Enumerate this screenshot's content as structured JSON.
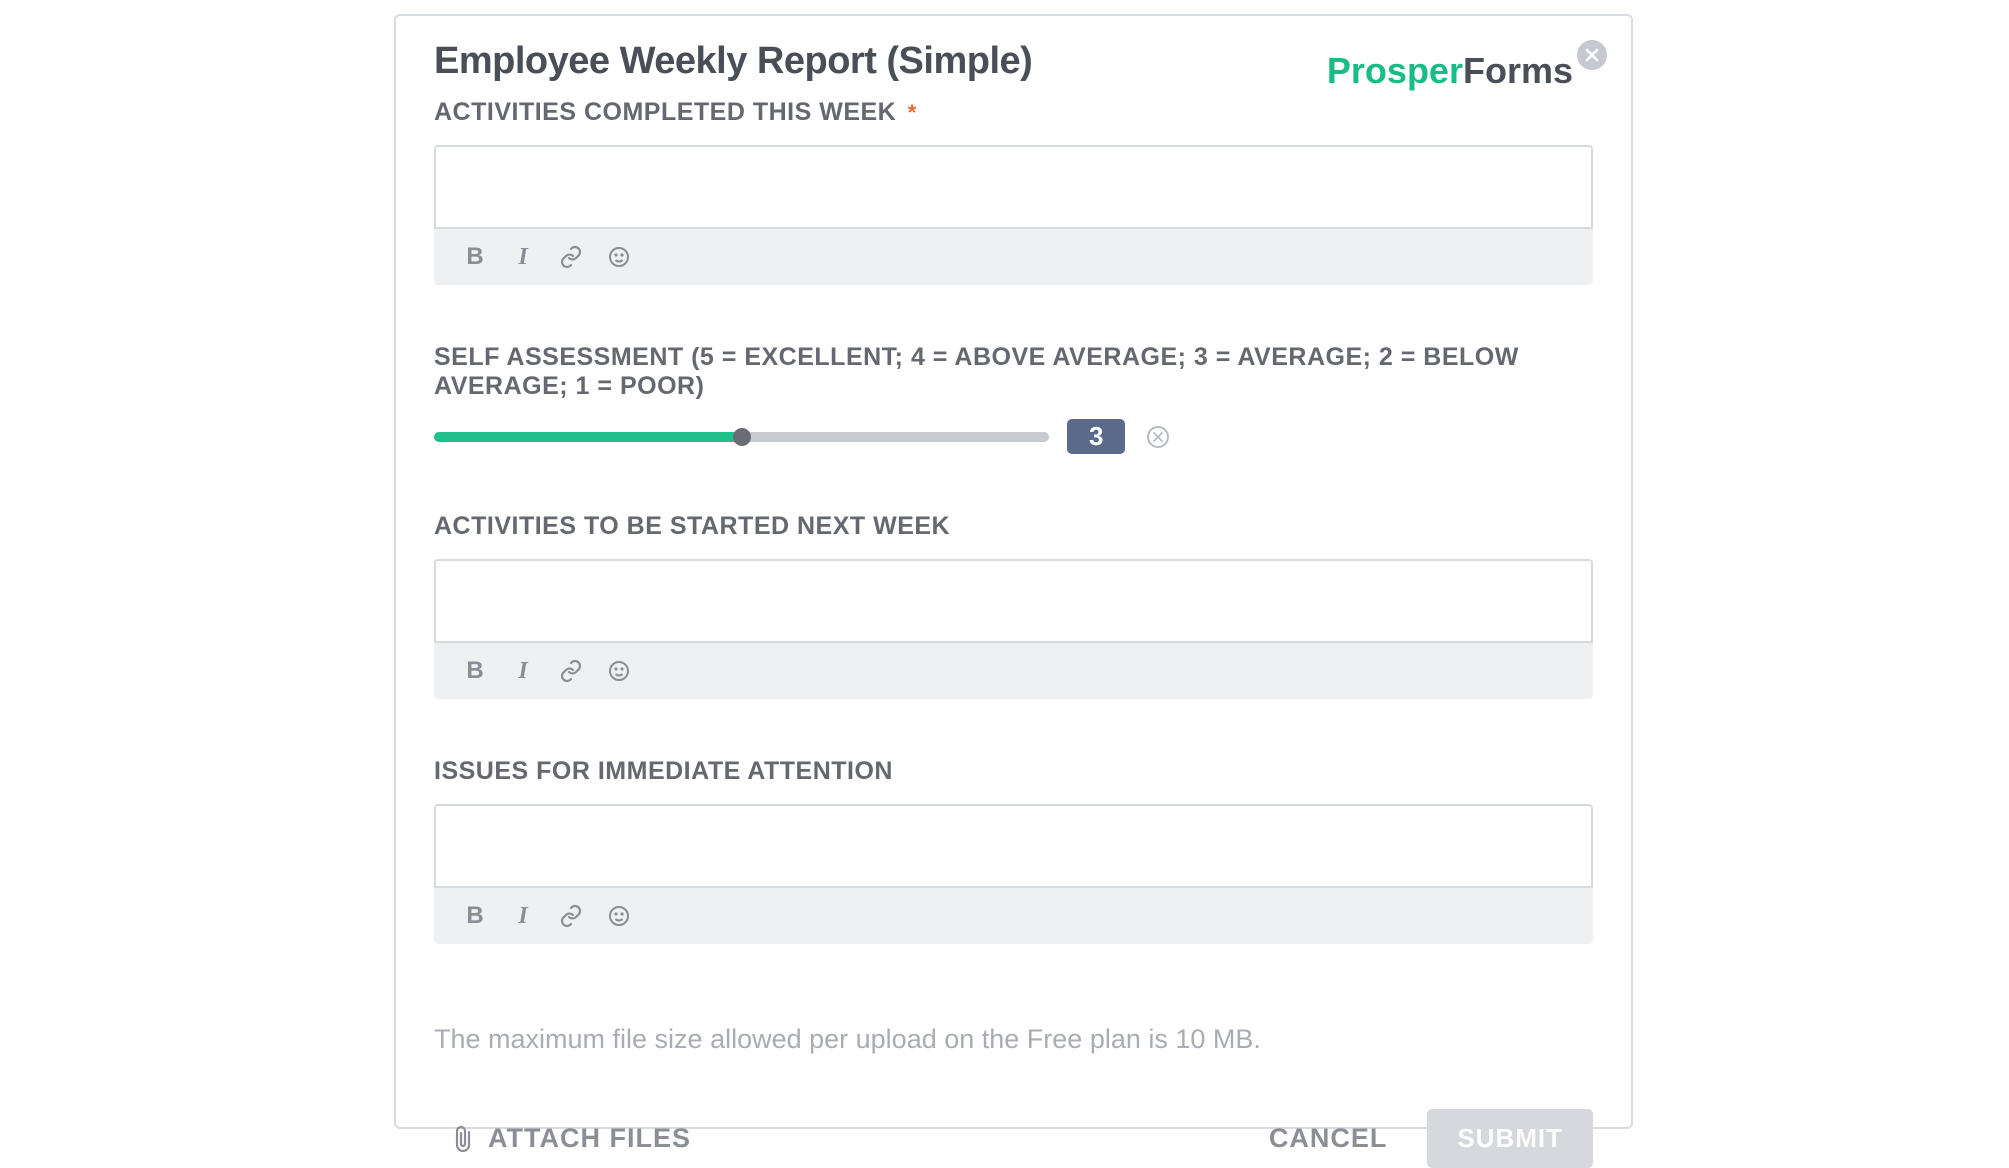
{
  "form": {
    "title": "Employee Weekly Report (Simple)",
    "brand_part1": "Prosper",
    "brand_part2": "Forms"
  },
  "fields": {
    "activities_completed": {
      "label": "ACTIVITIES COMPLETED THIS WEEK",
      "required_mark": "*",
      "value": ""
    },
    "self_assessment": {
      "label": "SELF ASSESSMENT (5 = EXCELLENT; 4 = ABOVE AVERAGE; 3 = AVERAGE; 2 = BELOW AVERAGE; 1 = POOR)",
      "value": "3",
      "min": 1,
      "max": 5,
      "fill_percent": 50
    },
    "activities_next": {
      "label": "ACTIVITIES TO BE STARTED NEXT WEEK",
      "value": ""
    },
    "issues": {
      "label": "ISSUES FOR IMMEDIATE ATTENTION",
      "value": ""
    }
  },
  "upload": {
    "note": "The maximum file size allowed per upload on the Free plan is 10 MB.",
    "attach_label": "ATTACH FILES"
  },
  "actions": {
    "cancel": "CANCEL",
    "submit": "SUBMIT"
  },
  "toolbar": {
    "bold": "B",
    "italic": "I"
  }
}
